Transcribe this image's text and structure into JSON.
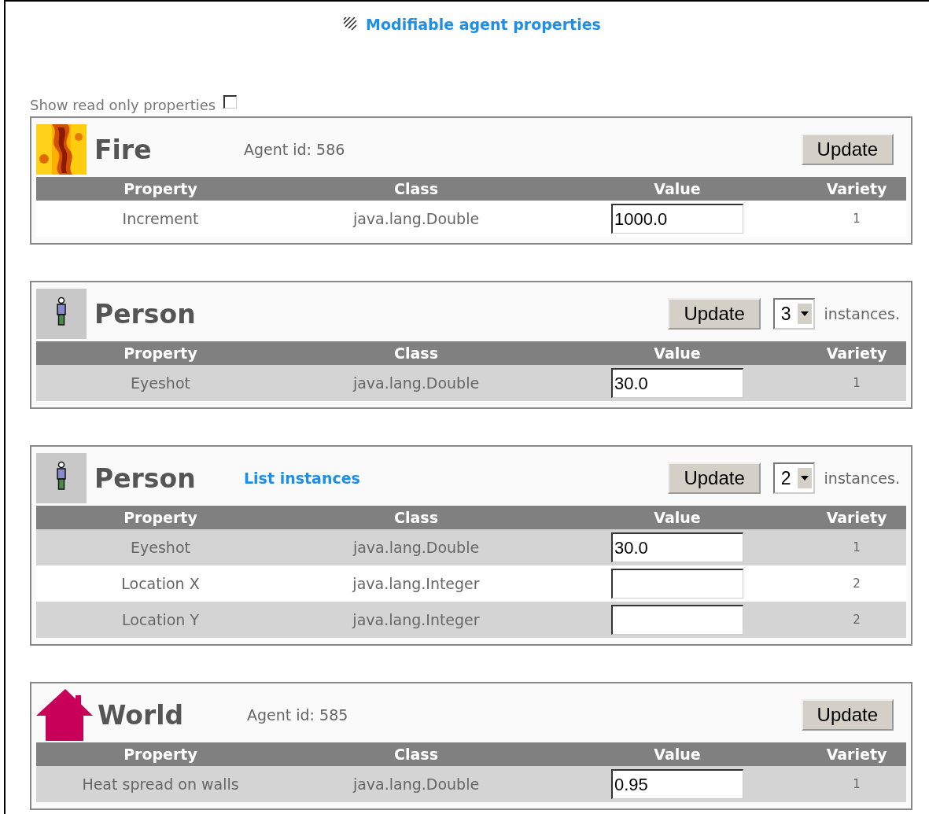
{
  "title": {
    "text": "Modifiable agent properties"
  },
  "show_read_only": {
    "label": "Show read only properties",
    "checked": false
  },
  "agents": [
    {
      "kind": "fire",
      "name": "Fire",
      "agent_id": "Agent id: 586",
      "button": "Update",
      "columns": [
        "Property",
        "Class",
        "Value",
        "Variety"
      ],
      "rows": [
        {
          "property": "Increment",
          "class": "java.lang.Double",
          "value": "1000.0",
          "variety": "1",
          "highlighted": false
        }
      ]
    },
    {
      "kind": "person",
      "name": "Person",
      "button": "Update",
      "instances": {
        "value": "3",
        "suffix": "instances."
      },
      "columns": [
        "Property",
        "Class",
        "Value",
        "Variety"
      ],
      "rows": [
        {
          "property": "Eyeshot",
          "class": "java.lang.Double",
          "value": "30.0",
          "variety": "1",
          "highlighted": true
        }
      ]
    },
    {
      "kind": "person",
      "name": "Person",
      "link": "List instances",
      "button": "Update",
      "instances": {
        "value": "2",
        "suffix": "instances."
      },
      "columns": [
        "Property",
        "Class",
        "Value",
        "Variety"
      ],
      "rows": [
        {
          "property": "Eyeshot",
          "class": "java.lang.Double",
          "value": "30.0",
          "variety": "1",
          "highlighted": true
        },
        {
          "property": "Location X",
          "class": "java.lang.Integer",
          "variety": "2",
          "highlighted": false
        },
        {
          "property": "Location Y",
          "class": "java.lang.Integer",
          "variety": "2",
          "highlighted": true
        }
      ]
    },
    {
      "kind": "house",
      "name": "World",
      "agent_id": "Agent id: 585",
      "button": "Update",
      "columns": [
        "Property",
        "Class",
        "Value",
        "Variety"
      ],
      "rows": [
        {
          "property": "Heat spread on walls",
          "class": "java.lang.Double",
          "value": "0.95",
          "variety": "1",
          "highlighted": true
        }
      ]
    }
  ]
}
